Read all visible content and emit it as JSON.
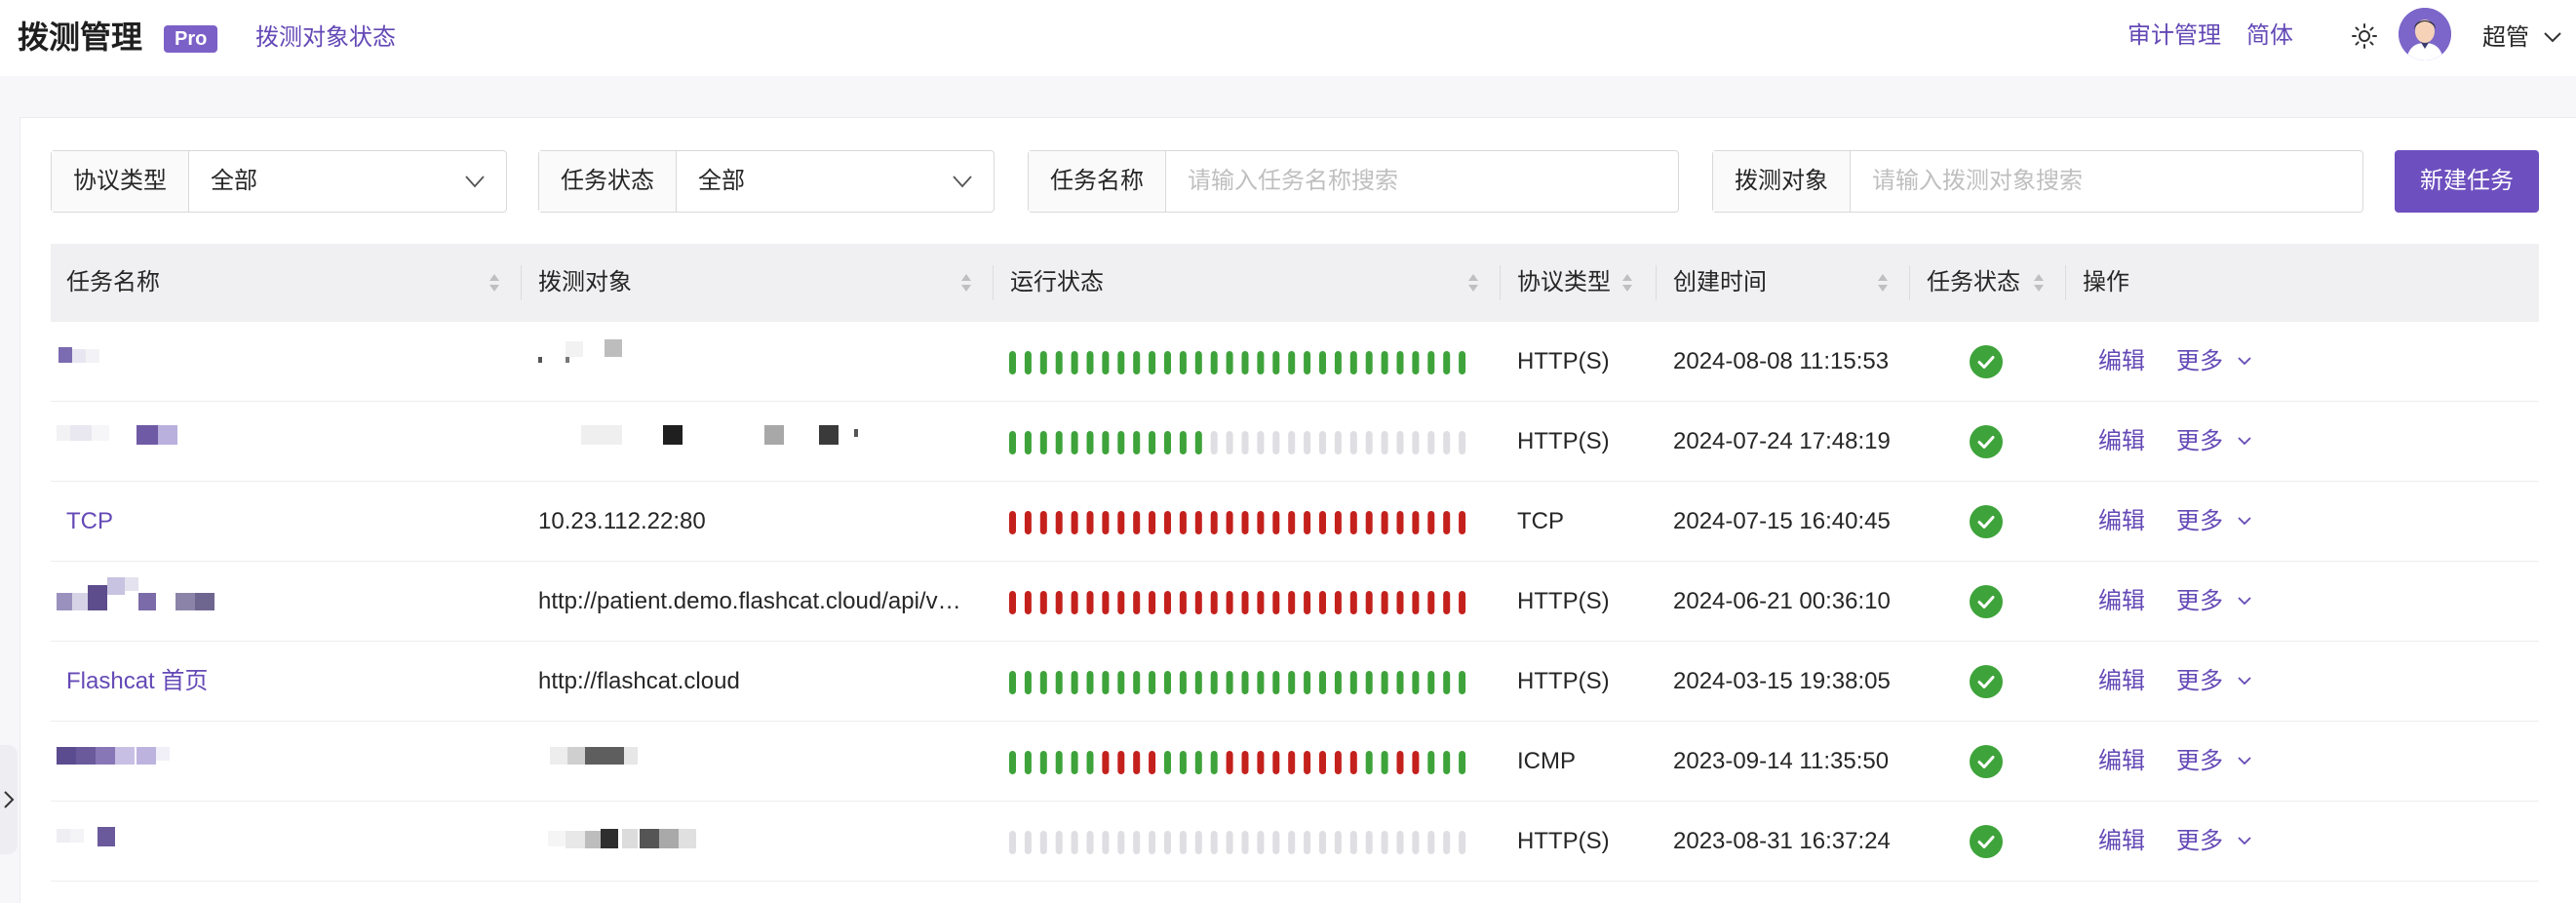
{
  "header": {
    "title": "拨测管理",
    "badge": "Pro",
    "nav_link": "拨测对象状态",
    "audit_link": "审计管理",
    "language": "简体",
    "user_name": "超管",
    "icons": [
      "sun-icon",
      "avatar",
      "chevron-down-icon"
    ]
  },
  "filters": {
    "protocol": {
      "label": "协议类型",
      "value": "全部"
    },
    "status": {
      "label": "任务状态",
      "value": "全部"
    },
    "task_name": {
      "label": "任务名称",
      "placeholder": "请输入任务名称搜索"
    },
    "target": {
      "label": "拨测对象",
      "placeholder": "请输入拨测对象搜索"
    },
    "new_task_label": "新建任务"
  },
  "table": {
    "columns": [
      "任务名称",
      "拨测对象",
      "运行状态",
      "协议类型",
      "创建时间",
      "任务状态",
      "操作"
    ],
    "rows": [
      {
        "name": "",
        "target": "",
        "run_status": "GGGGGGGGGGGGGGGGGGGGGGGGGGGGGG",
        "protocol": "HTTP(S)",
        "created": "2024-08-08 11:15:53",
        "task_status": "enabled",
        "edit": "编辑",
        "more": "更多"
      },
      {
        "name": "",
        "target": "",
        "run_status": "GGGGGGGGGGGGGNNNNNNNNNNNNNNNNN",
        "protocol": "HTTP(S)",
        "created": "2024-07-24 17:48:19",
        "task_status": "enabled",
        "edit": "编辑",
        "more": "更多"
      },
      {
        "name": "TCP",
        "target": "10.23.112.22:80",
        "run_status": "RRRRRRRRRRRRRRRRRRRRRRRRRRRRRR",
        "protocol": "TCP",
        "created": "2024-07-15 16:40:45",
        "task_status": "enabled",
        "edit": "编辑",
        "more": "更多"
      },
      {
        "name": "",
        "target": "http://patient.demo.flashcat.cloud/api/v…",
        "run_status": "RRRRRRRRRRRRRRRRRRRRRRRRRRRRRR",
        "protocol": "HTTP(S)",
        "created": "2024-06-21 00:36:10",
        "task_status": "enabled",
        "edit": "编辑",
        "more": "更多"
      },
      {
        "name": "Flashcat 首页",
        "target": "http://flashcat.cloud",
        "run_status": "GGGGGGGGGGGGGGGGGGGGGGGGGGGGGG",
        "protocol": "HTTP(S)",
        "created": "2024-03-15 19:38:05",
        "task_status": "enabled",
        "edit": "编辑",
        "more": "更多"
      },
      {
        "name": "",
        "target": "",
        "run_status": "GGGGGGRRRRGGGGRRRRRRRRRGGRRGGG",
        "protocol": "ICMP",
        "created": "2023-09-14 11:35:50",
        "task_status": "enabled",
        "edit": "编辑",
        "more": "更多"
      },
      {
        "name": "",
        "target": "",
        "run_status": "NNNNNNNNNNNNNNNNNNNNNNNNNNNNNN",
        "protocol": "HTTP(S)",
        "created": "2023-08-31 16:37:24",
        "task_status": "enabled",
        "edit": "编辑",
        "more": "更多"
      }
    ]
  },
  "colors": {
    "accent": "#6d4fbf",
    "link": "#6449b6",
    "bar_green": "#3ea33a",
    "bar_red": "#c4211d",
    "bar_gray": "#dedee3",
    "status_ok": "#3ea33a"
  }
}
